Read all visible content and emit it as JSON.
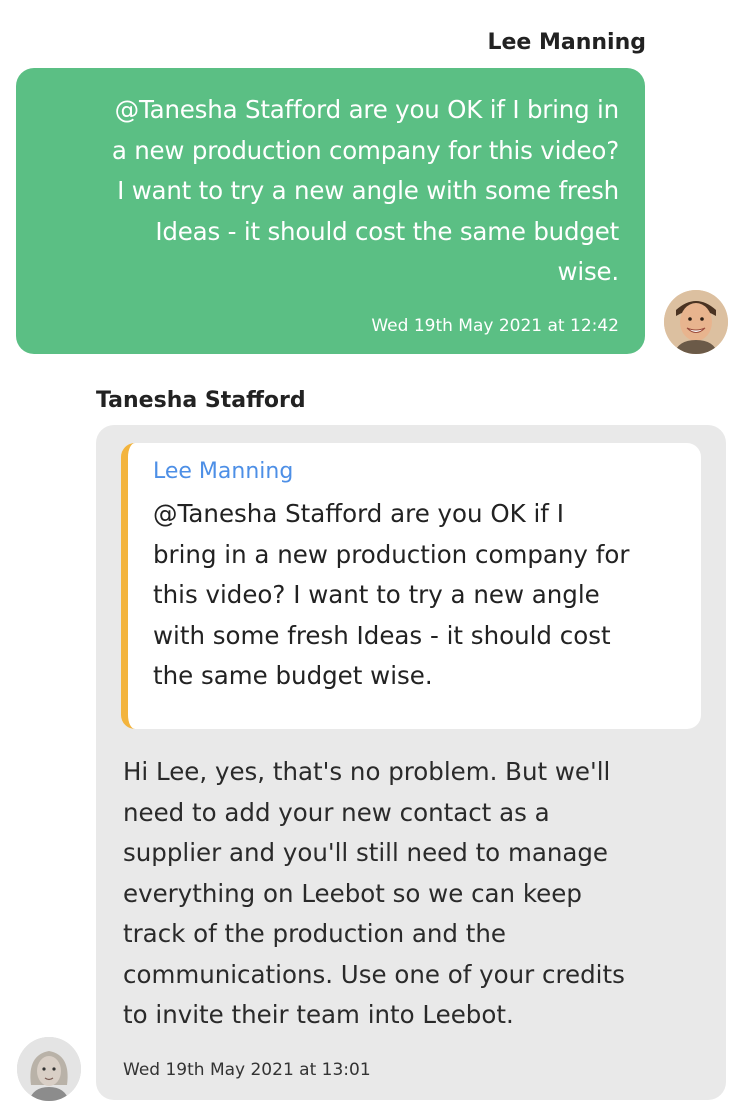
{
  "outgoing": {
    "sender": "Lee Manning",
    "lines": [
      "@Tanesha Stafford are you OK if I bring in",
      "a new production company for this video?",
      "I want to try a new angle with some fresh",
      "Ideas - it should cost the same budget",
      "wise."
    ],
    "timestamp": "Wed 19th May 2021 at 12:42"
  },
  "incoming": {
    "sender": "Tanesha Stafford",
    "quote": {
      "author": "Lee Manning",
      "lines": [
        "@Tanesha Stafford are you OK if I",
        "bring in a new production company for",
        "this video? I want to try a new angle",
        "with some fresh Ideas - it should cost",
        "the same budget wise."
      ]
    },
    "lines": [
      "Hi Lee, yes, that's no problem. But we'll",
      "need to add your new contact as a",
      "supplier and you'll still need to manage",
      "everything on Leebot so we can keep",
      "track of the production and the",
      "communications. Use one of your credits",
      "to invite their team into Leebot."
    ],
    "timestamp": "Wed 19th May 2021 at 13:01"
  },
  "colors": {
    "outgoing_bubble": "#5bbf84",
    "incoming_bubble": "#e9e9e9",
    "quote_accent": "#f3b43d",
    "quote_author": "#4d8fe6"
  }
}
